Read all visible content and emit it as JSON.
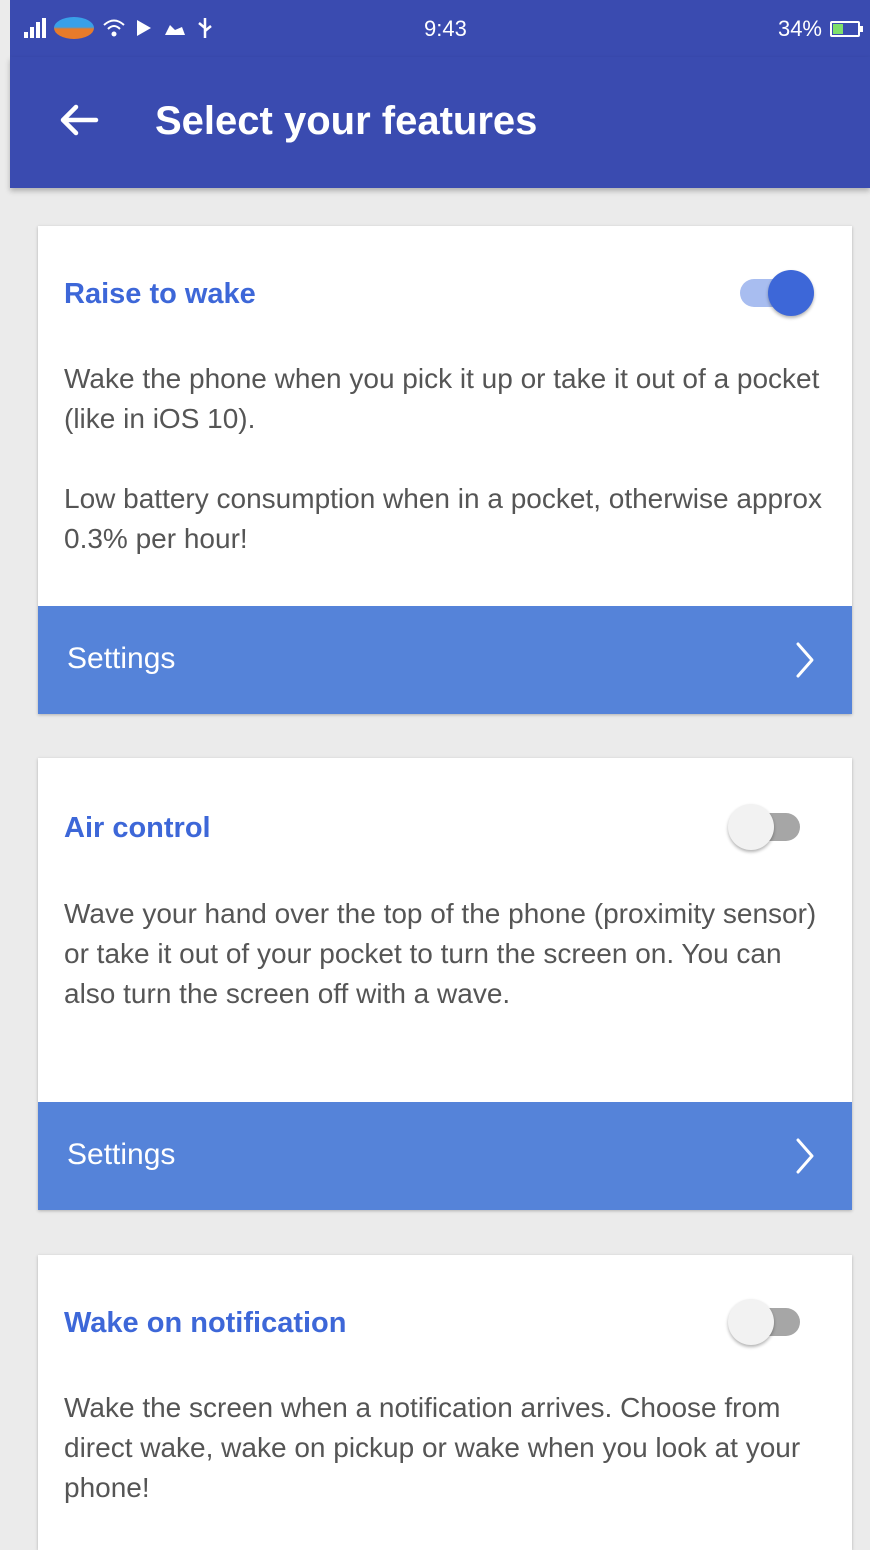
{
  "status_bar": {
    "time": "9:43",
    "battery_percent": "34%",
    "icons": [
      "signal-icon",
      "carrier-icon",
      "wifi-icon",
      "cast-icon",
      "cloud-icon",
      "usb-icon",
      "battery-icon"
    ]
  },
  "app_bar": {
    "title": "Select your features",
    "back_icon": "back-arrow-icon"
  },
  "features": [
    {
      "title": "Raise to wake",
      "enabled": true,
      "description": "Wake the phone when you pick it up or take it out of a pocket (like in iOS 10).",
      "description_2": "Low battery consumption when in a pocket, otherwise approx 0.3% per hour!",
      "settings_label": "Settings"
    },
    {
      "title": "Air control",
      "enabled": false,
      "description": "Wave your hand over the top of the phone (proximity sensor) or take it out of your pocket to turn the screen on. You can also turn the screen off with a wave.",
      "settings_label": "Settings"
    },
    {
      "title": "Wake on notification",
      "enabled": false,
      "description": "Wake the screen when a notification arrives. Choose from direct wake, wake on pickup or wake when you look at your phone!"
    }
  ],
  "colors": {
    "primary": "#3a4bb0",
    "accent": "#3d67d8",
    "settings_bar": "#5583d9",
    "background": "#ebebeb"
  }
}
